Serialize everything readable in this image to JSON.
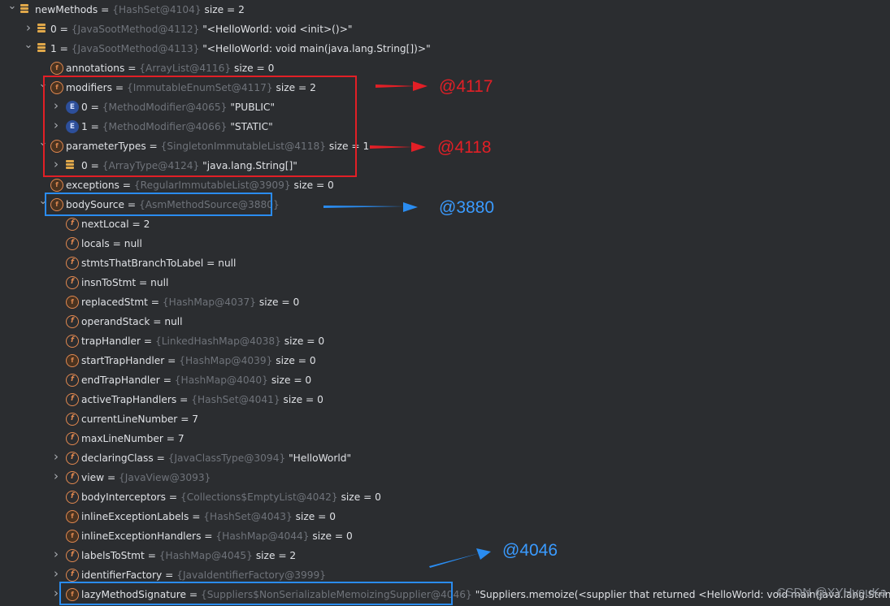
{
  "rows": [
    {
      "kind": "list",
      "expanded": true,
      "name": "newMethods",
      "eq": " = ",
      "ref": "{HashSet@4104}",
      "val": "  size = 2"
    },
    {
      "kind": "list",
      "expanded": false,
      "name": "0",
      "eq": " = ",
      "ref": "{JavaSootMethod@4112}",
      "val": " \"<HelloWorld: void <init>()>\""
    },
    {
      "kind": "list",
      "expanded": true,
      "name": "1",
      "eq": " = ",
      "ref": "{JavaSootMethod@4113}",
      "val": " \"<HelloWorld: void main(java.lang.String[])>\""
    },
    {
      "kind": "fl",
      "expanded": null,
      "name": "annotations",
      "eq": " = ",
      "ref": "{ArrayList@4116}",
      "val": "  size = 0"
    },
    {
      "kind": "fl",
      "expanded": true,
      "name": "modifiers",
      "eq": " = ",
      "ref": "{ImmutableEnumSet@4117}",
      "val": "  size = 2"
    },
    {
      "kind": "enum",
      "expanded": false,
      "name": "0",
      "eq": " = ",
      "ref": "{MethodModifier@4065}",
      "val": " \"PUBLIC\""
    },
    {
      "kind": "enum",
      "expanded": false,
      "name": "1",
      "eq": " = ",
      "ref": "{MethodModifier@4066}",
      "val": " \"STATIC\""
    },
    {
      "kind": "fl",
      "expanded": true,
      "name": "parameterTypes",
      "eq": " = ",
      "ref": "{SingletonImmutableList@4118}",
      "val": "  size = 1"
    },
    {
      "kind": "list",
      "expanded": false,
      "name": "0",
      "eq": " = ",
      "ref": "{ArrayType@4124}",
      "val": " \"java.lang.String[]\""
    },
    {
      "kind": "fl",
      "expanded": null,
      "name": "exceptions",
      "eq": " = ",
      "ref": "{RegularImmutableList@3909}",
      "val": "  size = 0"
    },
    {
      "kind": "fl",
      "expanded": true,
      "name": "bodySource",
      "eq": " = ",
      "ref": "{AsmMethodSource@3880}",
      "val": ""
    },
    {
      "kind": "f",
      "expanded": null,
      "name": "nextLocal",
      "eq": " = ",
      "ref": "",
      "val": "2"
    },
    {
      "kind": "f",
      "expanded": null,
      "name": "locals",
      "eq": " = ",
      "ref": "",
      "val": "null"
    },
    {
      "kind": "f",
      "expanded": null,
      "name": "stmtsThatBranchToLabel",
      "eq": " = ",
      "ref": "",
      "val": "null"
    },
    {
      "kind": "f",
      "expanded": null,
      "name": "insnToStmt",
      "eq": " = ",
      "ref": "",
      "val": "null"
    },
    {
      "kind": "fl",
      "expanded": null,
      "name": "replacedStmt",
      "eq": " = ",
      "ref": "{HashMap@4037}",
      "val": "  size = 0"
    },
    {
      "kind": "f",
      "expanded": null,
      "name": "operandStack",
      "eq": " = ",
      "ref": "",
      "val": "null"
    },
    {
      "kind": "f",
      "expanded": null,
      "name": "trapHandler",
      "eq": " = ",
      "ref": "{LinkedHashMap@4038}",
      "val": "  size = 0"
    },
    {
      "kind": "fl",
      "expanded": null,
      "name": "startTrapHandler",
      "eq": " = ",
      "ref": "{HashMap@4039}",
      "val": "  size = 0"
    },
    {
      "kind": "f",
      "expanded": null,
      "name": "endTrapHandler",
      "eq": " = ",
      "ref": "{HashMap@4040}",
      "val": "  size = 0"
    },
    {
      "kind": "f",
      "expanded": null,
      "name": "activeTrapHandlers",
      "eq": " = ",
      "ref": "{HashSet@4041}",
      "val": "  size = 0"
    },
    {
      "kind": "f",
      "expanded": null,
      "name": "currentLineNumber",
      "eq": " = ",
      "ref": "",
      "val": "7"
    },
    {
      "kind": "f",
      "expanded": null,
      "name": "maxLineNumber",
      "eq": " = ",
      "ref": "",
      "val": "7"
    },
    {
      "kind": "f",
      "expanded": false,
      "name": "declaringClass",
      "eq": " = ",
      "ref": "{JavaClassType@3094}",
      "val": " \"HelloWorld\""
    },
    {
      "kind": "f",
      "expanded": false,
      "name": "view",
      "eq": " = ",
      "ref": "{JavaView@3093}",
      "val": ""
    },
    {
      "kind": "f",
      "expanded": null,
      "name": "bodyInterceptors",
      "eq": " = ",
      "ref": "{Collections$EmptyList@4042}",
      "val": "  size = 0"
    },
    {
      "kind": "fl",
      "expanded": null,
      "name": "inlineExceptionLabels",
      "eq": " = ",
      "ref": "{HashSet@4043}",
      "val": "  size = 0"
    },
    {
      "kind": "fl",
      "expanded": null,
      "name": "inlineExceptionHandlers",
      "eq": " = ",
      "ref": "{HashMap@4044}",
      "val": "  size = 0"
    },
    {
      "kind": "f",
      "expanded": false,
      "name": "labelsToStmt",
      "eq": " = ",
      "ref": "{HashMap@4045}",
      "val": "  size = 2"
    },
    {
      "kind": "f",
      "expanded": false,
      "name": "identifierFactory",
      "eq": " = ",
      "ref": "{JavaIdentifierFactory@3999}",
      "val": ""
    },
    {
      "kind": "fl",
      "expanded": false,
      "name": "lazyMethodSignature",
      "eq": " = ",
      "ref": "{Suppliers$NonSerializableMemoizingSupplier@4046}",
      "val": " \"Suppliers.memoize(<supplier that returned <HelloWorld: void main(java.lang.String[])>)\""
    }
  ],
  "annotations": {
    "red1": "@4117",
    "red2": "@4118",
    "blue1": "@3880",
    "blue2": "@4046"
  },
  "watermark": "CSDN @XYHyouKa",
  "colors": {
    "red": "#e21f26",
    "blue": "#2a8cf0",
    "background": "#2b2d30"
  }
}
